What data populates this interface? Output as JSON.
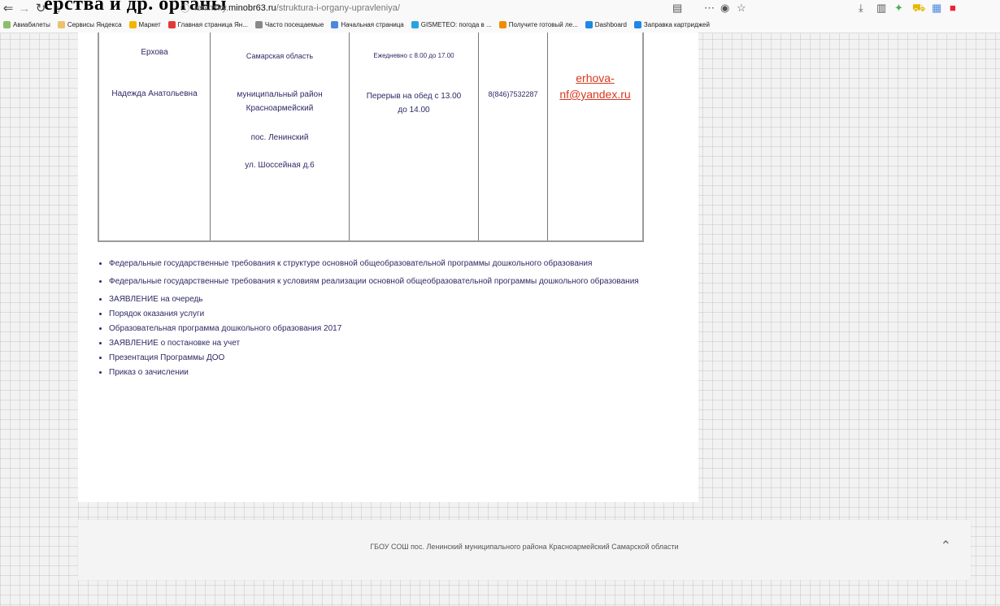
{
  "browser": {
    "url_domain": "leninsky.minobr63.ru",
    "url_path": "/struktura-i-organy-upravleniya/",
    "url_prefix": "leninsky.",
    "url_host": "minobr63.ru",
    "heading_fragment": "ерства и др. органы",
    "bookmarks": [
      "Авиабилеты",
      "Сервисы Яндекса",
      "Маркет",
      "Главная страница Ян...",
      "Часто посещаемые",
      "Начальная страница",
      "GISMETEO: погода в ...",
      "Получите готовый ле...",
      "Dashboard",
      "Заправка картриджей"
    ]
  },
  "table": {
    "name_lines": [
      "Ерхова",
      "Надежда Анатольевна"
    ],
    "address_lines": [
      "Самарская область",
      "муниципальный район Красноармейский",
      "пос. Ленинский",
      "ул. Шоссейная д.6"
    ],
    "schedule_lines": [
      "Ежедневно с 8.00 до 17.00",
      "Перерыв на обед с 13.00 до 14.00"
    ],
    "phone": "8(846)7532287",
    "email_line1": "erhova-",
    "email_line2": "nf@yandex.ru"
  },
  "docs": [
    "Федеральные государственные требования к структуре основной общеобразовательной программы дошкольного образования",
    "Федеральные государственные требования к условиям реализации основной общеобразовательной программы дошкольного образования",
    "ЗАЯВЛЕНИЕ на очередь",
    "Порядок оказания услуги",
    "Образовательная программа дошкольного образования 2017",
    "ЗАЯВЛЕНИЕ о постановке на учет",
    "Презентация Программы ДОО",
    "Приказ о зачислении"
  ],
  "footer": {
    "text": "ГБОУ СОШ пос. Ленинский муниципального района Красноармейский Самарской области"
  },
  "icons": [
    "back-icon",
    "forward-icon",
    "reload-icon",
    "home-icon",
    "info-icon",
    "reader-icon",
    "more-icon",
    "pocket-icon",
    "star-icon",
    "download-icon",
    "library-icon",
    "scroll-up-icon"
  ]
}
